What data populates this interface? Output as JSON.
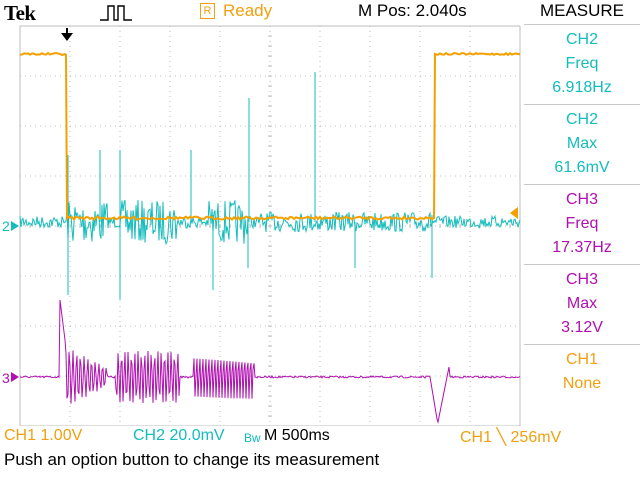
{
  "colors": {
    "ch1": "#f5a000",
    "ch2": "#14bcbc",
    "ch3": "#b010b0",
    "grid": "#bdbdbd",
    "background": "#ffffff"
  },
  "header": {
    "brand": "Tek",
    "status": "Ready",
    "status_badge": "R",
    "position": "M Pos: 2.040s",
    "trigger_icon": "pulse-trigger-icon"
  },
  "measure": {
    "title": "MEASURE",
    "items": [
      {
        "channel": "CH2",
        "type": "Freq",
        "value": "6.918Hz",
        "color": "#14bcbc"
      },
      {
        "channel": "CH2",
        "type": "Max",
        "value": "61.6mV",
        "color": "#14bcbc"
      },
      {
        "channel": "CH3",
        "type": "Freq",
        "value": "17.37Hz",
        "color": "#b010b0"
      },
      {
        "channel": "CH3",
        "type": "Max",
        "value": "3.12V",
        "color": "#b010b0"
      },
      {
        "channel": "CH1",
        "type": "None",
        "value": "",
        "color": "#f0a010"
      }
    ]
  },
  "scale": {
    "ch1": "CH1  1.00V",
    "ch2": "CH2  20.0mV",
    "ch2_bw": "Bw",
    "timebase": "M 500ms",
    "trigger": "CH1 ╲ 256mV"
  },
  "markers": {
    "ch2": "2",
    "ch3": "3"
  },
  "message": "Push an option button to change its measurement"
}
